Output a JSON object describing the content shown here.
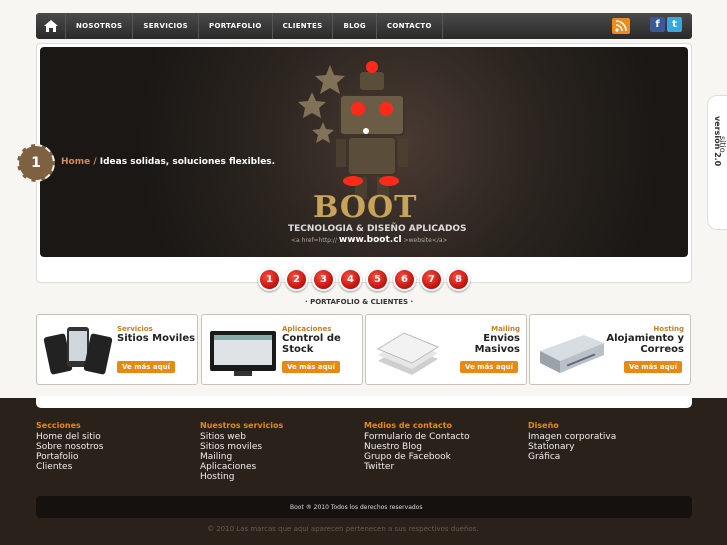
{
  "nav": {
    "items": [
      "NOSOTROS",
      "SERVICIOS",
      "PORTAFOLIO",
      "CLIENTES",
      "BLOG",
      "CONTACTO"
    ],
    "home_icon": "home-icon",
    "rss_icon": "rss-icon",
    "facebook_label": "f",
    "twitter_label": "t"
  },
  "banner": {
    "slide_number": "1",
    "crumb_home": "Home",
    "crumb_sep": " / ",
    "crumb_text": "Ideas solidas, soluciones flexibles.",
    "logo": "BOOT",
    "tagline": "TECNOLOGIA & DISEÑO APLICADOS",
    "url_prefix": "<a href=http://",
    "url": "www.boot.cl",
    "url_suffix": ">website</a>"
  },
  "side_tab": {
    "text1": "nuevo sitio ",
    "text2": "versión 2.0"
  },
  "pager": [
    "1",
    "2",
    "3",
    "4",
    "5",
    "6",
    "7",
    "8"
  ],
  "section_title": "· PORTAFOLIO & CLIENTES ·",
  "cards": [
    {
      "small": "Servicios",
      "big": "Sitios Moviles",
      "button": "Ve más aquí"
    },
    {
      "small": "Aplicaciones",
      "big": "Control de Stock",
      "button": "Ve más aquí"
    },
    {
      "small": "Mailing",
      "big": "Envios Masivos",
      "button": "Ve más aquí"
    },
    {
      "small": "Hosting",
      "big": "Alojamiento y Correos",
      "button": "Ve más aquí"
    }
  ],
  "footer": {
    "columns": [
      {
        "title": "Secciones",
        "links": [
          "Home del sitio",
          "Sobre nosotros",
          "Portafolio",
          "Clientes"
        ]
      },
      {
        "title": "Nuestros servicios",
        "links": [
          "Sitios web",
          "Sitios moviles",
          "Mailing",
          "Aplicaciones",
          "Hosting"
        ]
      },
      {
        "title": "Medios de contacto",
        "links": [
          "Formulario de Contacto",
          "Nuestro Blog",
          "Grupo de Facebook",
          "Twitter"
        ]
      },
      {
        "title": "Diseño",
        "links": [
          "Imagen corporativa",
          "Stationary",
          "Gráfica"
        ]
      }
    ],
    "copyright": "Boot ® 2010 Todos los derechos reservados",
    "legal": "© 2010 Las marcas que aquí aparecen pertenecen a sus respectivos dueños."
  },
  "colors": {
    "accent": "#e88a12",
    "nav": "#3a3a3a",
    "footer": "#2a211b",
    "pager": "#d0201a"
  }
}
